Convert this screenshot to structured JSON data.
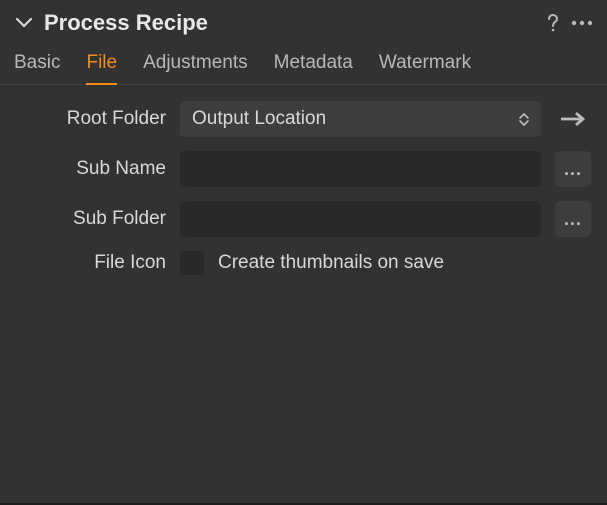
{
  "header": {
    "title": "Process Recipe"
  },
  "tabs": {
    "basic": "Basic",
    "file": "File",
    "adjustments": "Adjustments",
    "metadata": "Metadata",
    "watermark": "Watermark"
  },
  "form": {
    "root_folder": {
      "label": "Root Folder",
      "value": "Output Location"
    },
    "sub_name": {
      "label": "Sub Name",
      "value": ""
    },
    "sub_folder": {
      "label": "Sub Folder",
      "value": ""
    },
    "file_icon": {
      "label": "File Icon",
      "checkbox_label": "Create thumbnails on save"
    }
  },
  "buttons": {
    "ellipsis": "..."
  }
}
